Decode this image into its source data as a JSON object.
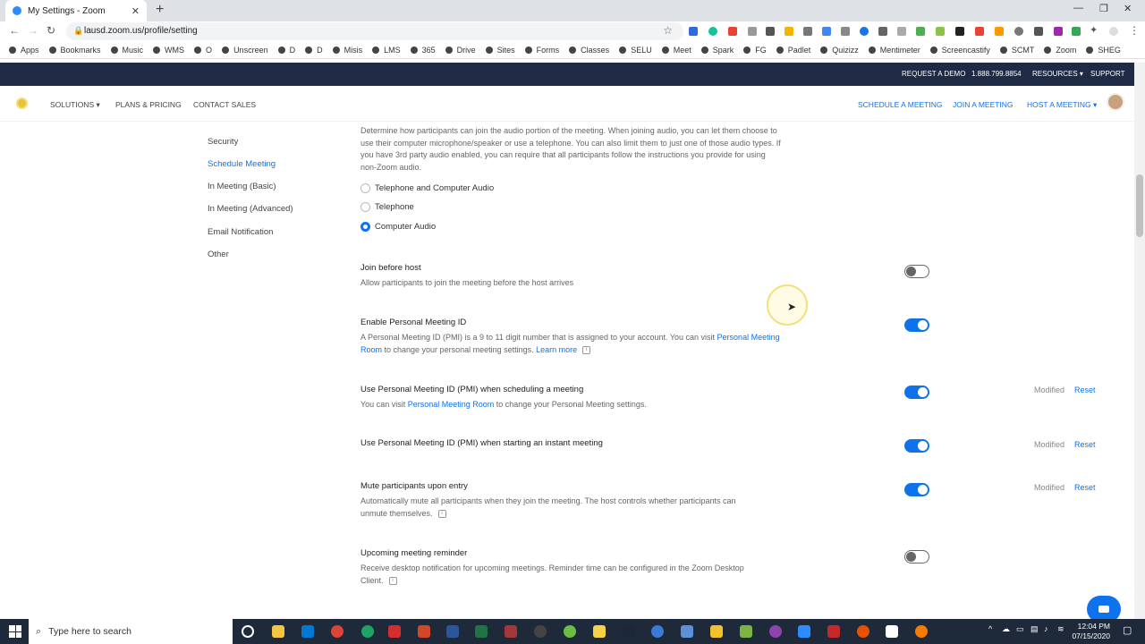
{
  "browser": {
    "tab_title": "My Settings - Zoom",
    "url": "lausd.zoom.us/profile/setting",
    "bookmarks": [
      "Apps",
      "Bookmarks",
      "Music",
      "WMS",
      "O",
      "Unscreen",
      "D",
      "D",
      "Misis",
      "LMS",
      "365",
      "Drive",
      "Sites",
      "Forms",
      "Classes",
      "SELU",
      "Meet",
      "Spark",
      "FG",
      "Padlet",
      "Quizizz",
      "Mentimeter",
      "Screencastify",
      "SCMT",
      "Zoom",
      "SHEG"
    ]
  },
  "zoom_top": {
    "request_demo": "REQUEST A DEMO",
    "phone": "1.888.799.8854",
    "resources": "RESOURCES ▾",
    "support": "SUPPORT"
  },
  "zoom_nav": {
    "solutions": "SOLUTIONS ▾",
    "plans": "PLANS & PRICING",
    "contact": "CONTACT SALES",
    "schedule": "SCHEDULE A MEETING",
    "join": "JOIN A MEETING",
    "host": "HOST A MEETING ▾"
  },
  "sidebar": [
    {
      "label": "Security"
    },
    {
      "label": "Schedule Meeting"
    },
    {
      "label": "In Meeting (Basic)"
    },
    {
      "label": "In Meeting (Advanced)"
    },
    {
      "label": "Email Notification"
    },
    {
      "label": "Other"
    }
  ],
  "audio": {
    "description": "Determine how participants can join the audio portion of the meeting. When joining audio, you can let them choose to use their computer microphone/speaker or use a telephone. You can also limit them to just one of those audio types. If you have 3rd party audio enabled, you can require that all participants follow the instructions you provide for using non-Zoom audio.",
    "options": [
      "Telephone and Computer Audio",
      "Telephone",
      "Computer Audio"
    ],
    "selected": "Computer Audio"
  },
  "settings": {
    "join_before_host": {
      "title": "Join before host",
      "desc": "Allow participants to join the meeting before the host arrives",
      "enabled": false
    },
    "pmi": {
      "title": "Enable Personal Meeting ID",
      "desc_pre": "A Personal Meeting ID (PMI) is a 9 to 11 digit number that is assigned to your account. You can visit ",
      "desc_link": "Personal Meeting Room",
      "desc_post": " to change your personal meeting settings. ",
      "learn_more": "Learn more",
      "enabled": true
    },
    "pmi_schedule": {
      "title": "Use Personal Meeting ID (PMI) when scheduling a meeting",
      "desc_pre": "You can visit ",
      "desc_link": "Personal Meeting Room",
      "desc_post": " to change your Personal Meeting settings.",
      "enabled": true,
      "modified": "Modified",
      "reset": "Reset"
    },
    "pmi_instant": {
      "title": "Use Personal Meeting ID (PMI) when starting an instant meeting",
      "enabled": true,
      "modified": "Modified",
      "reset": "Reset"
    },
    "mute": {
      "title": "Mute participants upon entry",
      "desc": "Automatically mute all participants when they join the meeting. The host controls whether participants can unmute themselves.",
      "enabled": true,
      "modified": "Modified",
      "reset": "Reset"
    },
    "reminder": {
      "title": "Upcoming meeting reminder",
      "desc": "Receive desktop notification for upcoming meetings. Reminder time can be configured in the Zoom Desktop Client.",
      "enabled": false
    }
  },
  "taskbar": {
    "search_placeholder": "Type here to search",
    "time": "12:04 PM",
    "date": "07/15/2020"
  },
  "colors": {
    "accent": "#0e72ed",
    "topbar": "#1f2a44",
    "taskbar": "#1e2a3a"
  }
}
